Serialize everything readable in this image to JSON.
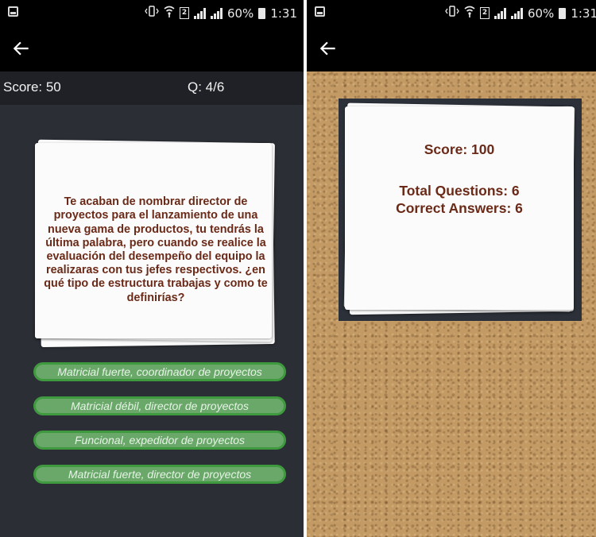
{
  "left_screen": {
    "status": {
      "battery": "60%",
      "time": "1:31"
    },
    "score_label": "Score: 50",
    "question_counter": "Q: 4/6",
    "question_text": "Te acaban de nombrar director de proyectos para el lanzamiento de una nueva gama de productos, tu tendrás la última palabra, pero cuando se realice la evaluación del desempeño del equipo la realizaras con tus jefes respectivos. ¿en qué tipo de estructura trabajas y como te definirías?",
    "answers": [
      "Matricial fuerte, coordinador de proyectos",
      "Matricial débil, director de proyectos",
      "Funcional, expedidor de proyectos",
      "Matricial fuerte, director de proyectos"
    ]
  },
  "right_screen": {
    "status": {
      "battery": "60%",
      "time": "1:31"
    },
    "result": {
      "score": "Score: 100",
      "total_questions": "Total Questions: 6",
      "correct_answers": "Correct Answers: 6"
    }
  },
  "icons": [
    "notification-icon",
    "vibrate-icon",
    "wifi-icon",
    "sim-icon",
    "signal-icon",
    "battery-icon",
    "back-arrow-icon"
  ],
  "colors": {
    "question_text": "#6b2a18",
    "answer_fill": "#6aa86a",
    "answer_border": "#3f9a3f",
    "background_dark": "#2b2e35",
    "cork": "#c39a64"
  }
}
